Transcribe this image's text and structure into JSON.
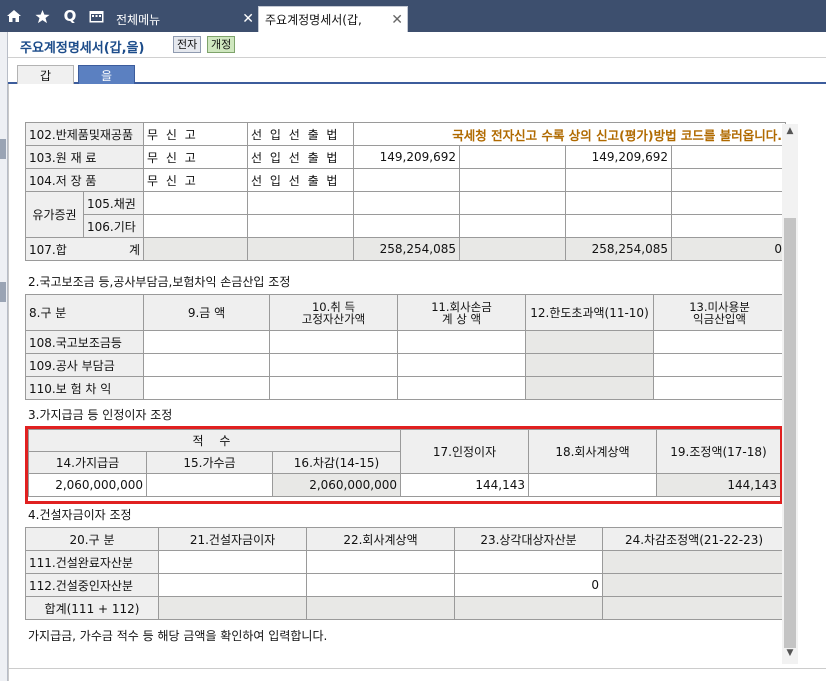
{
  "topbar": {
    "allmenu_label": "전체메뉴",
    "doc_tab_label": "주요계정명세서(갑,",
    "close": "✕"
  },
  "header": {
    "title": "주요계정명세서(갑,을)",
    "btn_ejeon": "전자",
    "btn_gaejeong": "개정"
  },
  "subtabs": {
    "gap": "갑",
    "eul": "을"
  },
  "notice": "국세청 전자신고 수록 상의 신고(평가)방법 코드를 불러옵니다.",
  "table1": {
    "r102": {
      "label": "102.반제품및재공품",
      "method": "무 신 고",
      "submethod": "선 입 선 출 법"
    },
    "r103": {
      "label": "103.원 재 료",
      "method": "무 신 고",
      "submethod": "선 입 선 출 법",
      "v1": "149,209,692",
      "v3": "149,209,692"
    },
    "r104": {
      "label": "104.저 장 품",
      "method": "무 신 고",
      "submethod": "선 입 선 출 법"
    },
    "group": "유가증권",
    "r105": {
      "label": "105.채권"
    },
    "r106": {
      "label": "106.기타"
    },
    "r107": {
      "label": "107.합",
      "label2": "계",
      "v1": "258,254,085",
      "v3": "258,254,085",
      "v4": "0"
    }
  },
  "section2": {
    "title": "2.국고보조금 등,공사부담금,보험차익 손금산입 조정",
    "headers": [
      "8.구 분",
      "9.금 액",
      "10.취 득",
      "고정자산가액",
      "11.회사손금",
      "계 상 액",
      "12.한도초과액(11-10)",
      "13.미사용분",
      "익금산입액"
    ],
    "rows": [
      "108.국고보조금등",
      "109.공사 부담금",
      "110.보 험 차 익"
    ]
  },
  "section3": {
    "title": "3.가지급금 등 인정이자 조정",
    "group_header": "적 수",
    "headers": [
      "14.가지급금",
      "15.가수금",
      "16.차감(14-15)",
      "17.인정이자",
      "18.회사계상액",
      "19.조정액(17-18)"
    ],
    "values": {
      "gajigeup": "2,060,000,000",
      "gasugeum": "",
      "chagam": "2,060,000,000",
      "injeong": "144,143",
      "hoesa": "",
      "jojeong": "144,143"
    }
  },
  "section4": {
    "title": "4.건설자금이자 조정",
    "headers": [
      "20.구 분",
      "21.건설자금이자",
      "22.회사계상액",
      "23.상각대상자산분",
      "24.차감조정액(21-22-23)"
    ],
    "rows": [
      "111.건설완료자산분",
      "112.건설중인자산분",
      "합계(111 + 112)"
    ],
    "r112_v3": "0"
  },
  "footer_hint": "가지급금, 가수금 적수 등 해당 금액을 확인하여 입력합니다.",
  "colors": {
    "accent": "#3d4f6e",
    "highlight": "#e02020",
    "notice": "#b06a00"
  }
}
